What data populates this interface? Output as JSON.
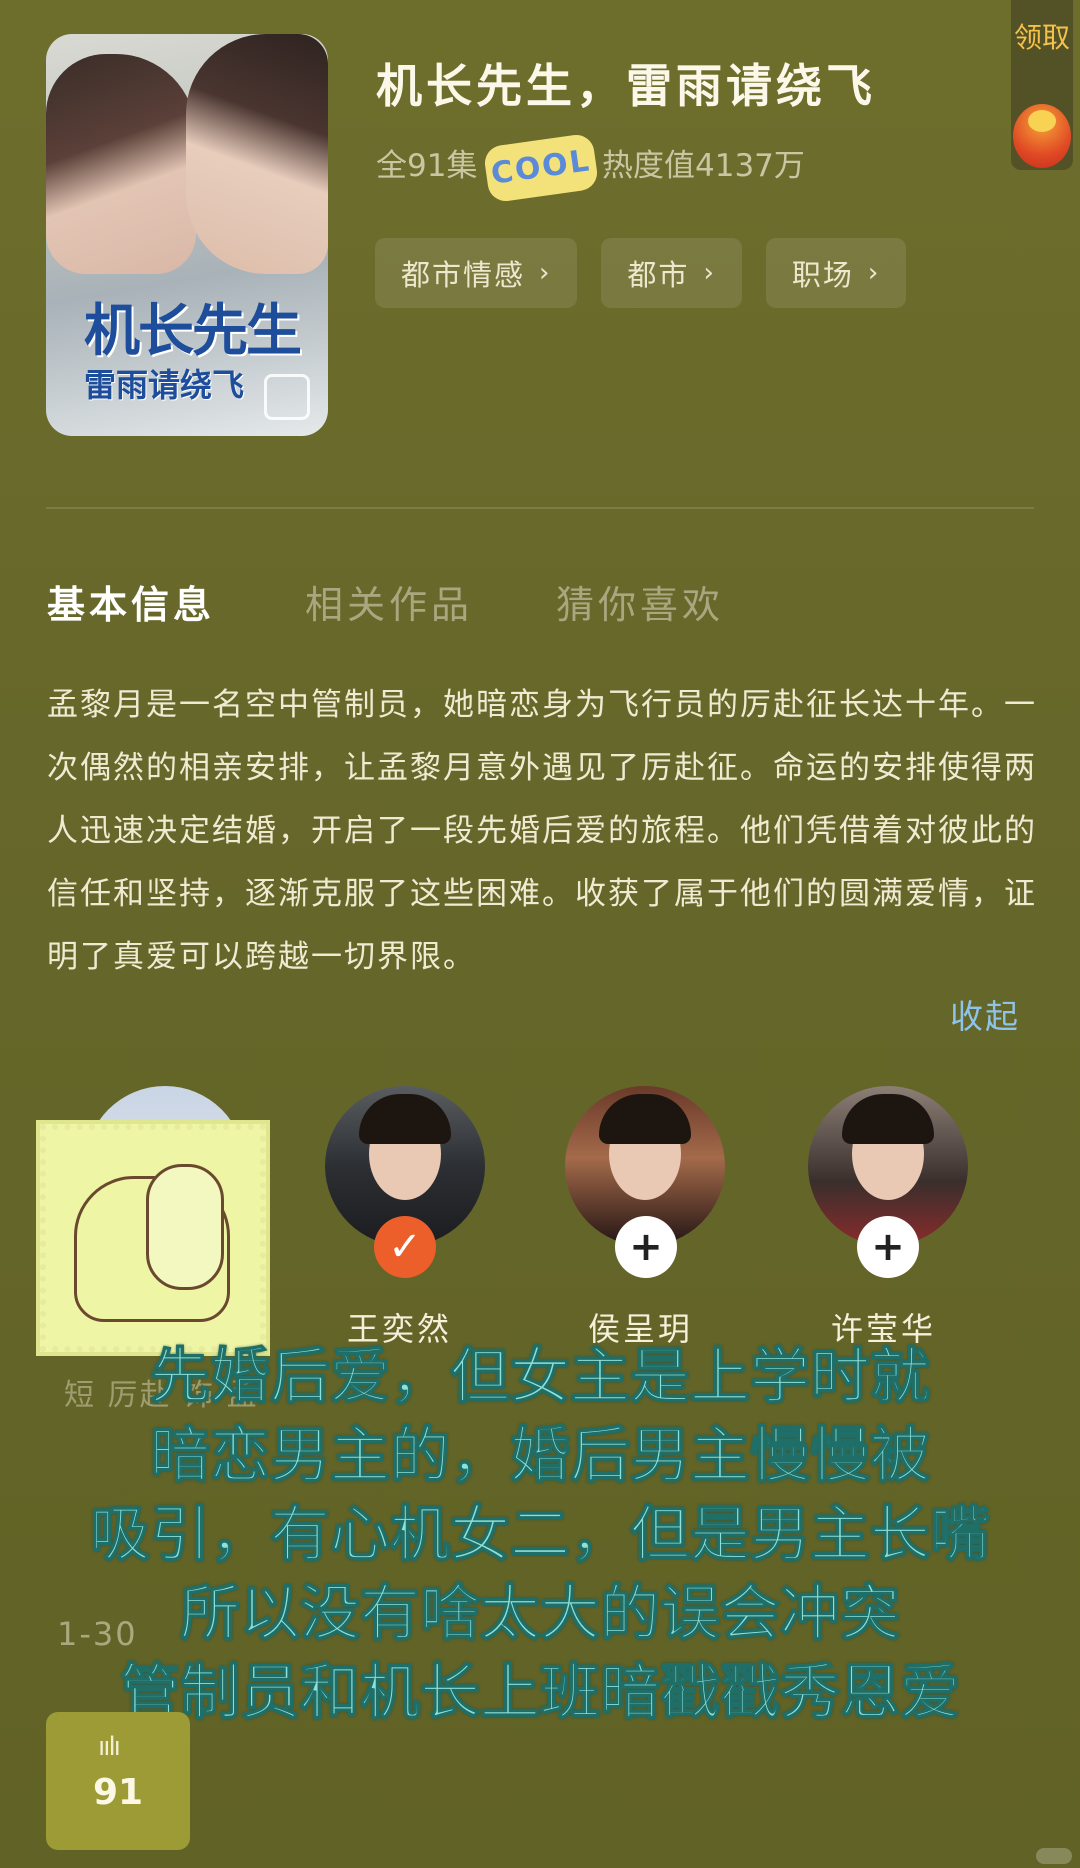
{
  "header": {
    "title": "机长先生，雷雨请绕飞",
    "episodes": "全91集",
    "heat": "热度值4137万",
    "sticker_text": "COOL",
    "poster_title_line1": "机长先生",
    "poster_title_line2": "雷雨请绕飞",
    "tags": [
      {
        "label": "都市情感"
      },
      {
        "label": "都市"
      },
      {
        "label": "职场"
      }
    ]
  },
  "reward": {
    "label": "领取"
  },
  "tabs": [
    {
      "label": "基本信息",
      "active": true
    },
    {
      "label": "相关作品",
      "active": false
    },
    {
      "label": "猜你喜欢",
      "active": false
    }
  ],
  "synopsis": {
    "text": "孟黎月是一名空中管制员，她暗恋身为飞行员的厉赴征长达十年。一次偶然的相亲安排，让孟黎月意外遇见了厉赴征。命运的安排使得两人迅速决定结婚，开启了一段先婚后爱的旅程。他们凭借着对彼此的信任和坚持，逐渐克服了这些困难。收获了属于他们的圆满爱情，证明了真爱可以跨越一切界限。",
    "collapse_label": "收起"
  },
  "cast": [
    {
      "name": "",
      "followed": null
    },
    {
      "name": "王奕然",
      "followed": true
    },
    {
      "name": "侯呈玥",
      "followed": false
    },
    {
      "name": "许莹华",
      "followed": false
    }
  ],
  "partially_hidden": {
    "row1": "短                   厉赴        饰 孟        ",
    "row2": "1-30"
  },
  "overlay_caption": {
    "lines": [
      "先婚后爱，但女主是上学时就",
      "暗恋男主的，婚后男主慢慢被",
      "吸引，有心机女二，但是男主长嘴",
      "所以没有啥太大的误会冲突",
      "管制员和机长上班暗戳戳秀恩爱"
    ]
  },
  "episode_box": {
    "number": "91"
  },
  "colors": {
    "background": "#6b6b2b",
    "accent_follow": "#ec5e2a",
    "collapse_link": "#8ec4ea",
    "caption": "#8fe1d8"
  },
  "icons": [
    "chevron-right-icon",
    "check-icon",
    "plus-icon",
    "red-envelope-icon",
    "equalizer-icon",
    "photo-icon"
  ]
}
